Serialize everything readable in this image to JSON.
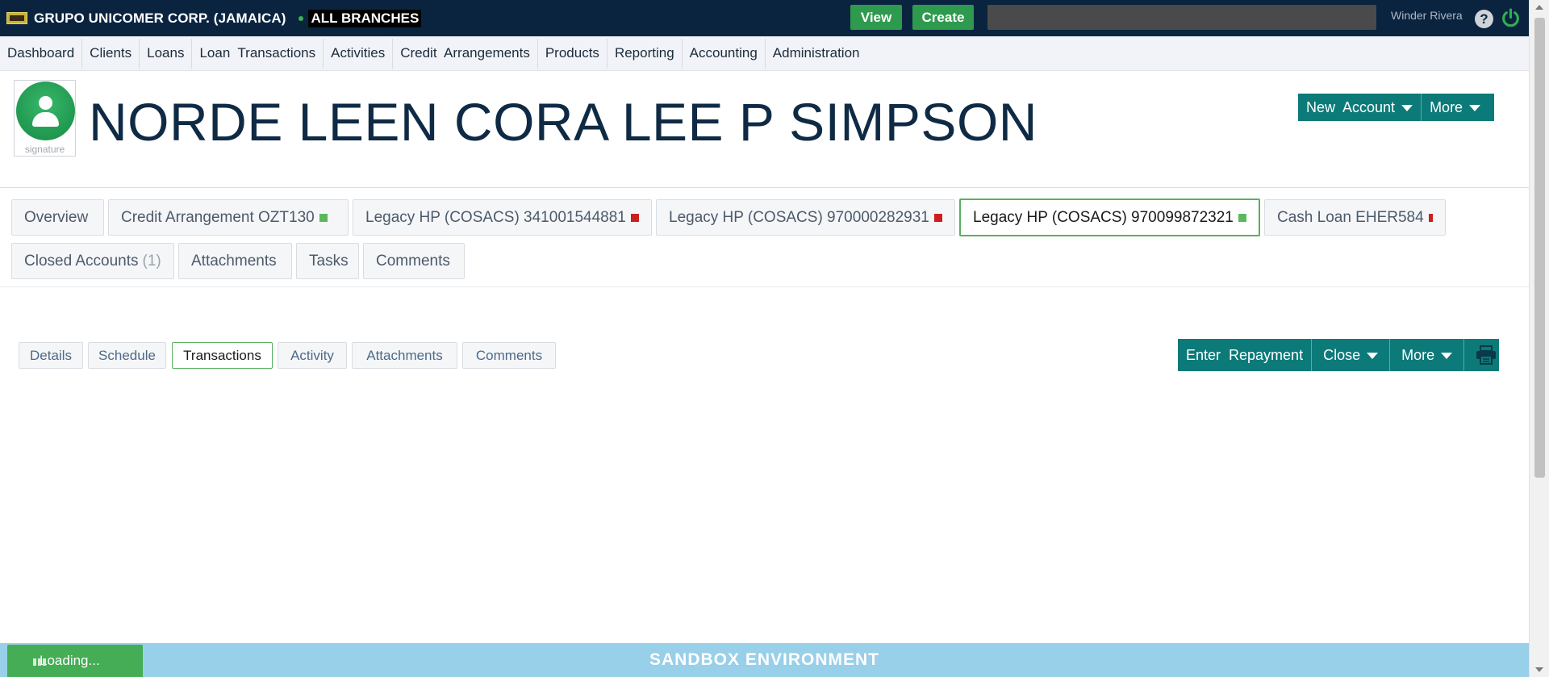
{
  "topbar": {
    "org_name": "GRUPO UNICOMER CORP. (JAMAICA)",
    "branch": "ALL BRANCHES",
    "view_label": "View",
    "create_label": "Create",
    "search_placeholder": "",
    "user_name": "Winder Rivera",
    "help_glyph": "?"
  },
  "nav": {
    "items": [
      "Dashboard",
      "Clients",
      "Loans",
      "Loan  Transactions",
      "Activities",
      "Credit  Arrangements",
      "Products",
      "Reporting",
      "Accounting",
      "Administration"
    ]
  },
  "client": {
    "avatar_label": "signature",
    "name": "NORDE LEEN CORA LEE P SIMPSON",
    "new_account_label": "New  Account",
    "more_label": "More"
  },
  "account_tabs": [
    {
      "label": "Overview",
      "status": "none"
    },
    {
      "label": "Credit Arrangement OZT130",
      "status": "green"
    },
    {
      "label": "Legacy HP (COSACS) 341001544881",
      "status": "red"
    },
    {
      "label": "Legacy HP (COSACS) 970000282931",
      "status": "red"
    },
    {
      "label": "Legacy HP (COSACS) 970099872321",
      "status": "green"
    },
    {
      "label": "Cash Loan EHER584",
      "status": "red"
    },
    {
      "label": "Closed Accounts",
      "count": "(1)"
    },
    {
      "label": "Attachments"
    },
    {
      "label": "Tasks"
    },
    {
      "label": "Comments"
    }
  ],
  "sub_tabs": [
    "Details",
    "Schedule",
    "Transactions",
    "Activity",
    "Attachments",
    "Comments"
  ],
  "sub_actions": {
    "enter_repayment": "Enter  Repayment",
    "close": "Close",
    "more": "More"
  },
  "footer": {
    "loading": "Loading...",
    "environment": "SANDBOX ENVIRONMENT"
  },
  "colors": {
    "topbar": "#0a2440",
    "teal": "#0c7a79",
    "green_button": "#2e9a4e",
    "status_green": "#5cb85c",
    "status_red": "#cc1f1f",
    "footer": "#98cfe9"
  }
}
